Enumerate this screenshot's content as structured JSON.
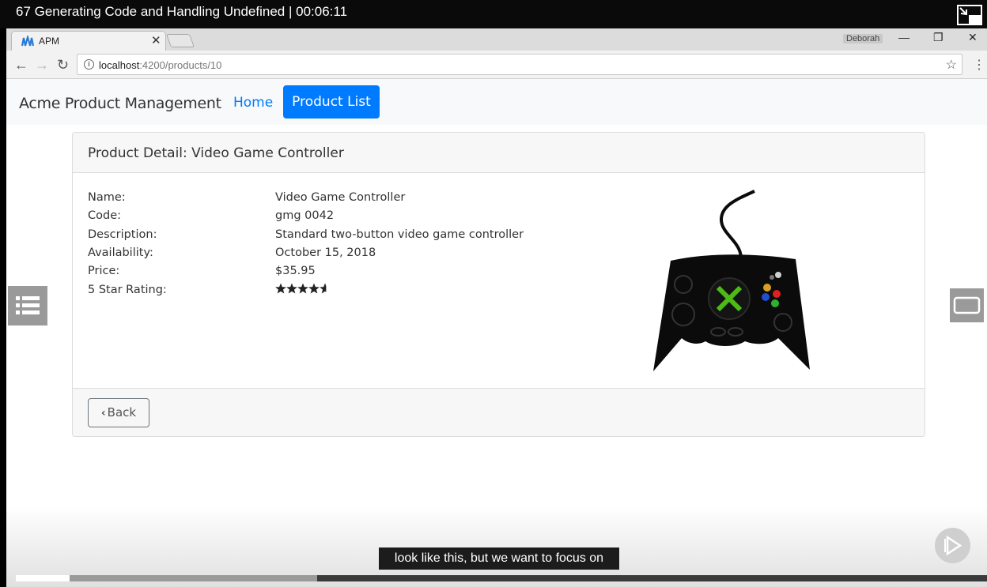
{
  "video": {
    "title": "67 Generating Code and Handling Undefined | 00:06:11",
    "caption": "look like this, but we want to focus on",
    "progress_played": 0.055,
    "progress_buffered": 0.31
  },
  "browser": {
    "tab_title": "APM",
    "tab_close": "✕",
    "profile": "Deborah",
    "url_host": "localhost",
    "url_path": ":4200/products/10"
  },
  "app": {
    "brand": "Acme Product Management",
    "nav_home": "Home",
    "nav_product_list": "Product List"
  },
  "detail": {
    "title": "Product Detail: Video Game Controller",
    "rows": [
      {
        "label": "Name:",
        "value": "Video Game Controller"
      },
      {
        "label": "Code:",
        "value": "gmg 0042"
      },
      {
        "label": "Description:",
        "value": "Standard two-button video game controller"
      },
      {
        "label": "Availability:",
        "value": "October 15, 2018"
      },
      {
        "label": "Price:",
        "value": "$35.95"
      },
      {
        "label": "5 Star Rating:",
        "value": ""
      }
    ],
    "rating": 4.6,
    "back_label": "Back"
  },
  "colors": {
    "primary": "#007bff",
    "controller_body": "#0b0b0b",
    "controller_x": "#4cbb17"
  }
}
